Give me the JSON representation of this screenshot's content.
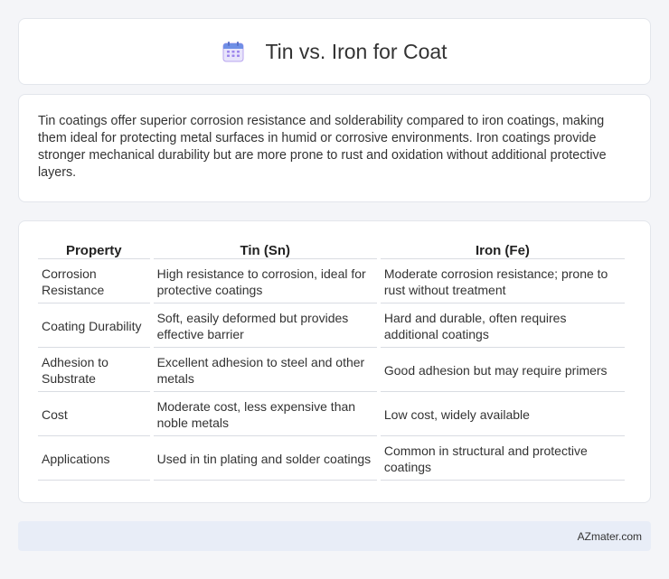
{
  "header": {
    "title": "Tin vs. Iron for Coat",
    "icon": "calendar-icon"
  },
  "intro": {
    "text": "Tin coatings offer superior corrosion resistance and solderability compared to iron coatings, making them ideal for protecting metal surfaces in humid or corrosive environments. Iron coatings provide stronger mechanical durability but are more prone to rust and oxidation without additional protective layers."
  },
  "table": {
    "headers": [
      "Property",
      "Tin (Sn)",
      "Iron (Fe)"
    ],
    "rows": [
      [
        "Corrosion Resistance",
        "High resistance to corrosion, ideal for protective coatings",
        "Moderate corrosion resistance; prone to rust without treatment"
      ],
      [
        "Coating Durability",
        "Soft, easily deformed but provides effective barrier",
        "Hard and durable, often requires additional coatings"
      ],
      [
        "Adhesion to Substrate",
        "Excellent adhesion to steel and other metals",
        "Good adhesion but may require primers"
      ],
      [
        "Cost",
        "Moderate cost, less expensive than noble metals",
        "Low cost, widely available"
      ],
      [
        "Applications",
        "Used in tin plating and solder coatings",
        "Common in structural and protective coatings"
      ]
    ]
  },
  "footer": {
    "text": "AZmater.com"
  },
  "colors": {
    "background": "#f4f5f8",
    "card": "#ffffff",
    "footer_bg": "#e8edf7",
    "icon_blue": "#6f8fe6",
    "icon_purple": "#b9a6ef"
  }
}
